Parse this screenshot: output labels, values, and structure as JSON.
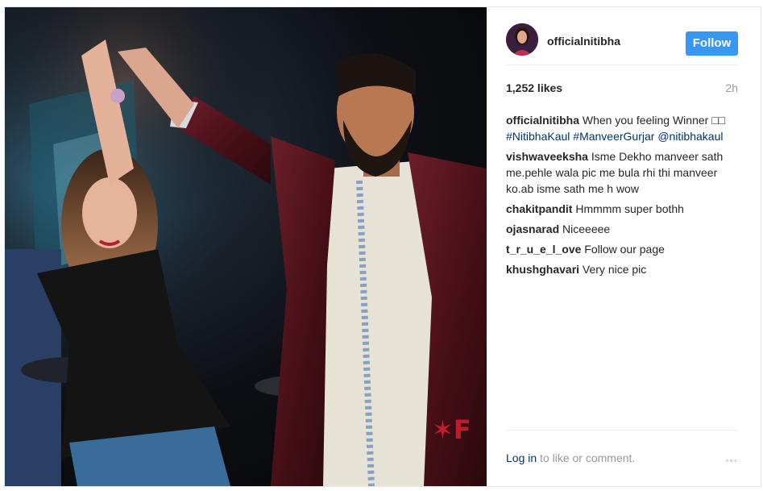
{
  "post": {
    "username": "officialnitibha",
    "follow_label": "Follow",
    "likes": "1,252 likes",
    "time_ago": "2h",
    "caption": {
      "author": "officialnitibha",
      "text": "When you feeling Winner □□",
      "tags": [
        "#NitibhaKaul",
        "#ManveerGurjar",
        "@nitibhakaul"
      ]
    },
    "comments": [
      {
        "author": "vishwaveeksha",
        "text": "Isme Dekho manveer sath me.pehle wala pic me bula rhi thi manveer ko.ab isme sath me h wow"
      },
      {
        "author": "chakitpandit",
        "text": "Hmmmm super bothh"
      },
      {
        "author": "ojasnarad",
        "text": "Niceeeee"
      },
      {
        "author": "t_r_u_e_l_ove",
        "text": "Follow our page"
      },
      {
        "author": "khushghavari",
        "text": "Very nice pic"
      }
    ],
    "footer": {
      "login_link": "Log in",
      "login_suffix": " to like or comment.",
      "more_icon": "◦◦◦"
    }
  },
  "colors": {
    "follow_button": "#3897f0",
    "link": "#003569",
    "muted": "#999999"
  }
}
